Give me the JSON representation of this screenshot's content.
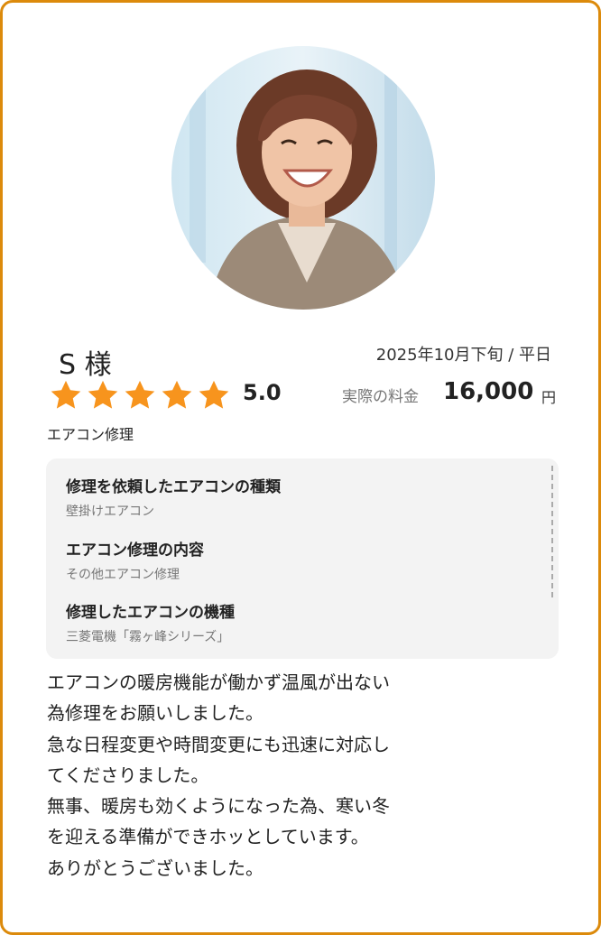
{
  "customer": {
    "name": "S 様",
    "photo_alt": "smiling-woman-photo"
  },
  "visit": {
    "date": "2025年10月下旬 / 平日"
  },
  "rating": {
    "value": "5.0",
    "stars": 5,
    "max_stars": 5,
    "star_color": "#f7941d"
  },
  "price": {
    "label": "実際の料金",
    "amount": "16,000",
    "unit": "円"
  },
  "service": {
    "name": "エアコン修理"
  },
  "details": [
    {
      "title": "修理を依頼したエアコンの種類",
      "value": "壁掛けエアコン"
    },
    {
      "title": "エアコン修理の内容",
      "value": "その他エアコン修理"
    },
    {
      "title": "修理したエアコンの機種",
      "value": "三菱電機「霧ヶ峰シリーズ」"
    }
  ],
  "review": {
    "lines": [
      "エアコンの暖房機能が働かず温風が出ない",
      "為修理をお願いしました。",
      "急な日程変更や時間変更にも迅速に対応し",
      "てくださりました。",
      "無事、暖房も効くようになった為、寒い冬",
      "を迎える準備ができホッとしています。",
      "ありがとうございました。"
    ]
  },
  "colors": {
    "border": "#dc8a0b",
    "panel_bg": "#f3f3f3"
  }
}
